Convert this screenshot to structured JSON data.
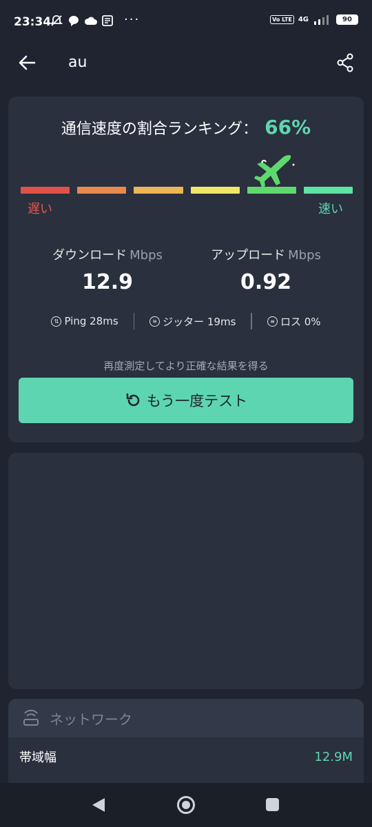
{
  "status_bar": {
    "time": "23:34",
    "network_type": "4G",
    "volte": "Vo LTE",
    "battery": "90",
    "overflow": "···"
  },
  "app_bar": {
    "title": "au",
    "back_icon": "arrow-left-icon",
    "share_icon": "share-icon"
  },
  "ranking": {
    "label": "通信速度の割合ランキング：",
    "percent": "66%",
    "segment_colors": [
      "#e0514a",
      "#e8894e",
      "#ecb556",
      "#f1e66a",
      "#5fd86e",
      "#5ee3a4"
    ],
    "active_segment": 5,
    "slow_label": "遅い",
    "fast_label": "速い"
  },
  "download": {
    "label": "ダウンロード",
    "unit": "Mbps",
    "value": "12.9"
  },
  "upload": {
    "label": "アップロード",
    "unit": "Mbps",
    "value": "0.92"
  },
  "stats": {
    "ping": "Ping 28ms",
    "jitter": "ジッター 19ms",
    "loss": "ロス 0%"
  },
  "retest": {
    "hint": "再度測定してより正確な結果を得る",
    "button_label": "もう一度テスト"
  },
  "network": {
    "title": "ネットワーク",
    "bandwidth_label": "帯域幅",
    "bandwidth_value": "12.9M"
  },
  "colors": {
    "accent": "#5dd5b1",
    "background": "#1f2430",
    "card": "#2a303d"
  }
}
